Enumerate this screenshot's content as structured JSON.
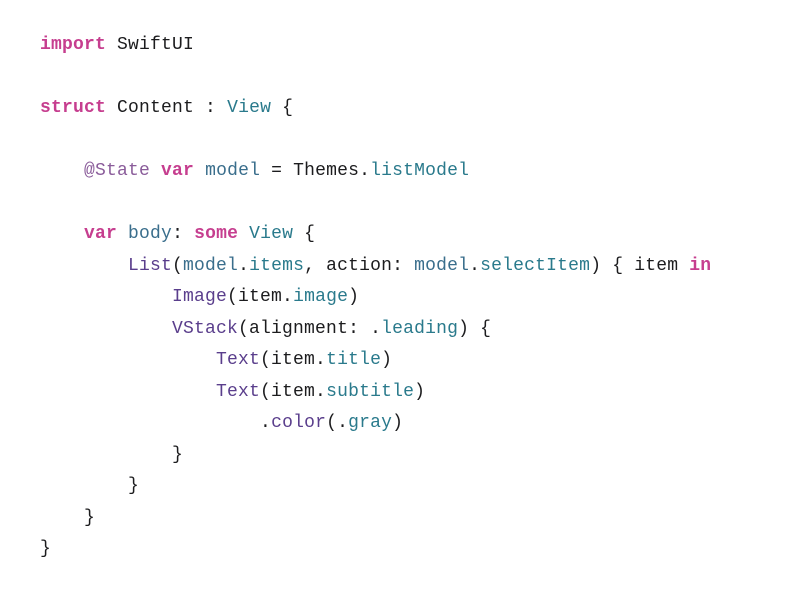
{
  "colors": {
    "keyword_pink": "#c63e8f",
    "type_teal": "#2a7a8c",
    "attribute_purple": "#8a5c9a",
    "member_teal": "#2a7a8c",
    "function_purple": "#5a3e8c",
    "plain": "#1c1c1e"
  },
  "code": {
    "l1": {
      "t1": "import",
      "t2": " SwiftUI"
    },
    "l2": "",
    "l3": {
      "t1": "struct",
      "t2": " ",
      "t3": "Content",
      "t4": " : ",
      "t5": "View",
      "t6": " {"
    },
    "l4": "",
    "l5": {
      "indent": "    ",
      "t1": "@State",
      "t2": " ",
      "t3": "var",
      "t4": " ",
      "t5": "model",
      "t6": " = ",
      "t7": "Themes",
      "t8": ".",
      "t9": "listModel"
    },
    "l6": "",
    "l7": {
      "indent": "    ",
      "t1": "var",
      "t2": " ",
      "t3": "body",
      "t4": ": ",
      "t5": "some",
      "t6": " ",
      "t7": "View",
      "t8": " {"
    },
    "l8": {
      "indent": "        ",
      "t1": "List",
      "t2": "(",
      "t3": "model",
      "t4": ".",
      "t5": "items",
      "t6": ", action: ",
      "t7": "model",
      "t8": ".",
      "t9": "selectItem",
      "t10": ") { item ",
      "t11": "in"
    },
    "l9": {
      "indent": "            ",
      "t1": "Image",
      "t2": "(item.",
      "t3": "image",
      "t4": ")"
    },
    "l10": {
      "indent": "            ",
      "t1": "VStack",
      "t2": "(alignment: .",
      "t3": "leading",
      "t4": ") {"
    },
    "l11": {
      "indent": "                ",
      "t1": "Text",
      "t2": "(item.",
      "t3": "title",
      "t4": ")"
    },
    "l12": {
      "indent": "                ",
      "t1": "Text",
      "t2": "(item.",
      "t3": "subtitle",
      "t4": ")"
    },
    "l13": {
      "indent": "                    ",
      "t1": ".",
      "t2": "color",
      "t3": "(.",
      "t4": "gray",
      "t5": ")"
    },
    "l14": {
      "indent": "            ",
      "t1": "}"
    },
    "l15": {
      "indent": "        ",
      "t1": "}"
    },
    "l16": {
      "indent": "    ",
      "t1": "}"
    },
    "l17": {
      "indent": "",
      "t1": "}"
    }
  }
}
